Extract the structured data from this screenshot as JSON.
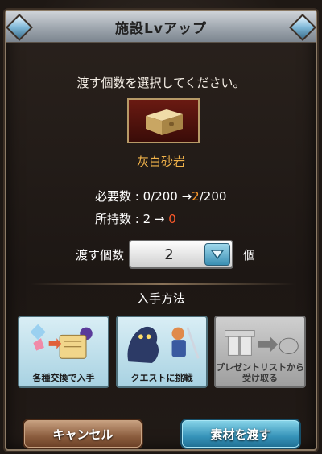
{
  "dialog": {
    "title": "施設Lvアップ",
    "instruction": "渡す個数を選択してください。",
    "item": {
      "name": "灰白砂岩",
      "icon": "stone-block-icon"
    },
    "stats": {
      "required_label": "必要数 : ",
      "required_from": "0/200",
      "required_arrow": " →",
      "required_to_num": "2",
      "required_to_rest": "/200",
      "owned_label": "所持数 : ",
      "owned_from": "2",
      "owned_arrow": " → ",
      "owned_to": "0"
    },
    "quantity": {
      "label": "渡す個数",
      "value": "2",
      "unit": "個"
    },
    "acquisition": {
      "title": "入手方法",
      "options": [
        {
          "label": "各種交換で入手",
          "enabled": true
        },
        {
          "label": "クエストに挑戦",
          "enabled": true
        },
        {
          "label": "プレゼントリストから\n受け取る",
          "enabled": false
        }
      ]
    },
    "buttons": {
      "cancel": "キャンセル",
      "confirm": "素材を渡す"
    }
  },
  "colors": {
    "accent_orange": "#ff9a2a",
    "accent_red": "#ff5a2a",
    "item_name": "#f0b24a"
  }
}
